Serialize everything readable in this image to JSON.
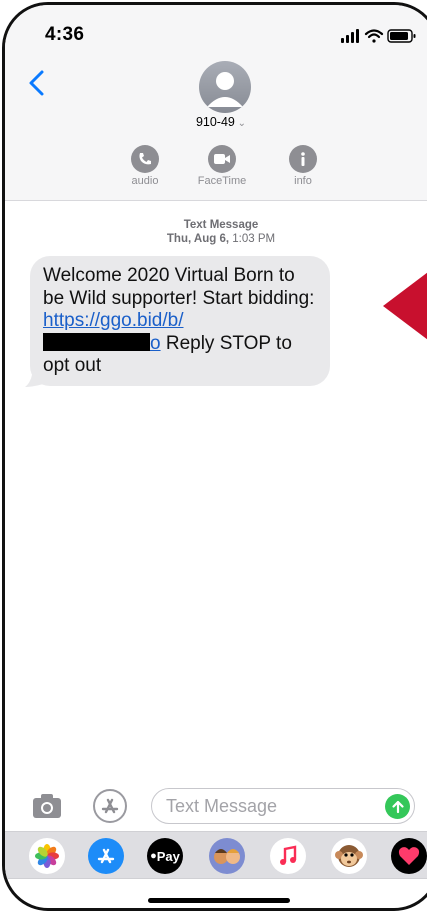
{
  "status_bar": {
    "time": "4:36"
  },
  "header": {
    "contact_name": "910-49",
    "chevron": "⌵",
    "actions": [
      {
        "label": "audio",
        "icon": "phone-icon"
      },
      {
        "label": "FaceTime",
        "icon": "video-camera-icon"
      },
      {
        "label": "info",
        "icon": "info-icon"
      }
    ]
  },
  "conversation": {
    "service": "Text Message",
    "timestamp_day": "Thu, Aug 6,",
    "timestamp_time": "1:03 PM",
    "message": {
      "text_before_link": "Welcome 2020 Virtual Born to be Wild supporter! Start bidding: ",
      "link": "https://ggo.bid/b/",
      "link_tail": "o",
      "text_after": " Reply STOP to opt out"
    }
  },
  "composer": {
    "placeholder": "Text Message"
  },
  "app_drawer": {
    "apps": [
      "photos-app-icon",
      "app-store-icon",
      "apple-pay-icon",
      "memoji-icon",
      "music-icon",
      "animoji-icon",
      "digital-touch-icon"
    ],
    "apple_pay_label": "Pay"
  },
  "colors": {
    "link": "#1a5fc9",
    "send": "#34c759",
    "pointer": "#c8102e",
    "bubble": "#e9e9eb"
  }
}
